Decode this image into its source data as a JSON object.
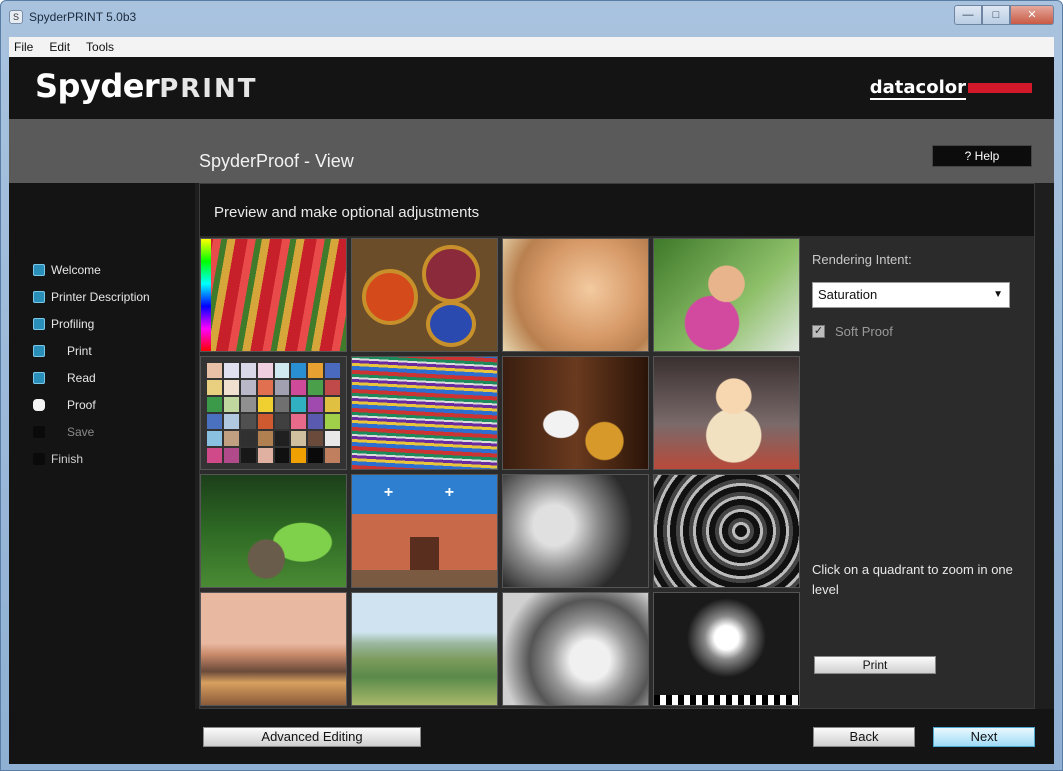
{
  "window": {
    "title": "SpyderPRINT 5.0b3",
    "app_icon": "S",
    "controls": [
      "minimize",
      "maximize",
      "close"
    ]
  },
  "menu": [
    "File",
    "Edit",
    "Tools"
  ],
  "brand": {
    "main": "Spyder",
    "sub": "PRINT",
    "partner": "datacolor",
    "partner_accent": "#d3182a"
  },
  "header": {
    "title": "SpyderProof - View",
    "help_label": "? Help"
  },
  "steps": [
    {
      "label": "Welcome",
      "state": "done"
    },
    {
      "label": "Printer Description",
      "state": "done"
    },
    {
      "label": "Profiling",
      "state": "done"
    },
    {
      "label": "Print",
      "state": "done"
    },
    {
      "label": "Read",
      "state": "done"
    },
    {
      "label": "Proof",
      "state": "current"
    },
    {
      "label": "Save",
      "state": "todo"
    },
    {
      "label": "Finish",
      "state": "todo"
    }
  ],
  "panel": {
    "title": "Preview and make optional adjustments"
  },
  "thumbnails": [
    "peppers",
    "plates",
    "face",
    "girl",
    "color-chart",
    "blanket",
    "guitarist",
    "doll",
    "garden",
    "church",
    "woman-bw",
    "stairs-bw",
    "sunset",
    "hills",
    "vespa-bw",
    "chess-bw"
  ],
  "options": {
    "rendering_intent_label": "Rendering Intent:",
    "rendering_intent_value": "Saturation",
    "soft_proof_label": "Soft Proof",
    "soft_proof_checked": true,
    "hint": "Click on a quadrant to zoom in one level",
    "print_label": "Print"
  },
  "footer": {
    "advanced_label": "Advanced Editing",
    "back_label": "Back",
    "next_label": "Next"
  },
  "colors": {
    "accent": "#2a8fb8",
    "next_button": "#9fdcf6",
    "background": "#1e1e1e"
  }
}
